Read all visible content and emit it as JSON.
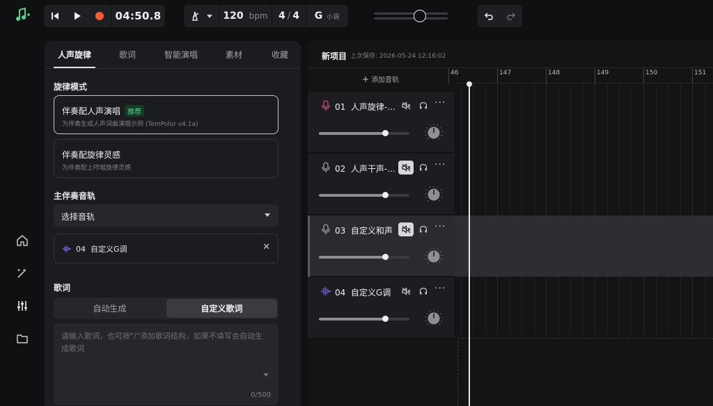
{
  "transport": {
    "time": "04:50.8",
    "bpm": "120",
    "bpm_unit": "bpm",
    "time_sig_num": "4",
    "time_sig_sep": "/",
    "time_sig_den": "4",
    "key": "G",
    "key_mode": "小调",
    "master_volume": 0.65
  },
  "panel": {
    "tabs": [
      "人声旋律",
      "歌词",
      "智能演唱",
      "素材",
      "收藏"
    ],
    "active_tab": 0,
    "melody_mode_label": "旋律模式",
    "modes": [
      {
        "title": "伴奏配人声演唱",
        "badge": "推荐",
        "desc": "为伴奏生成人声词曲演唱示例 (TemPolor v4.1a)",
        "selected": true
      },
      {
        "title": "伴奏配旋律灵感",
        "badge": "",
        "desc": "为伴奏配上哼唱旋律灵感",
        "selected": false
      }
    ],
    "main_track_label": "主伴奏音轨",
    "select_track_value": "选择音轨",
    "selected_track": {
      "number": "04",
      "name": "自定义G调"
    },
    "lyrics_label": "歌词",
    "lyrics_modes": [
      "自动生成",
      "自定义歌词"
    ],
    "lyrics_active_mode": 1,
    "lyrics_placeholder": "请输入歌词，也可按\"/\"添加歌词结构，如果不填写会自动生成歌词",
    "lyrics_count": "0/500"
  },
  "workspace": {
    "project_title": "新项目",
    "last_saved": "上次保存: 2026-05-24 12:16:02",
    "add_track": "添加音轨",
    "ruler_ticks": [
      "46",
      "147",
      "148",
      "149",
      "150",
      "151"
    ],
    "tracks": [
      {
        "number": "01",
        "name": "人声旋律-...",
        "icon": "microphone-icon",
        "icon_color": "#e0457b",
        "mute_on": false,
        "volume": 0.73,
        "active": false
      },
      {
        "number": "02",
        "name": "人声干声-...",
        "icon": "microphone-icon",
        "icon_color": "#9a9ba0",
        "mute_on": true,
        "volume": 0.73,
        "active": false
      },
      {
        "number": "03",
        "name": "自定义和声",
        "icon": "microphone-icon",
        "icon_color": "#9a9ba0",
        "mute_on": true,
        "volume": 0.73,
        "active": true
      },
      {
        "number": "04",
        "name": "自定义G调",
        "icon": "waveform-icon",
        "icon_color": "#7a6cf0",
        "mute_on": false,
        "volume": 0.73,
        "active": false
      }
    ]
  },
  "colors": {
    "accent_green": "#4fd28a",
    "record_red": "#ff5a2d",
    "vocal_pink": "#e0457b",
    "wave_purple": "#7a6cf0"
  }
}
